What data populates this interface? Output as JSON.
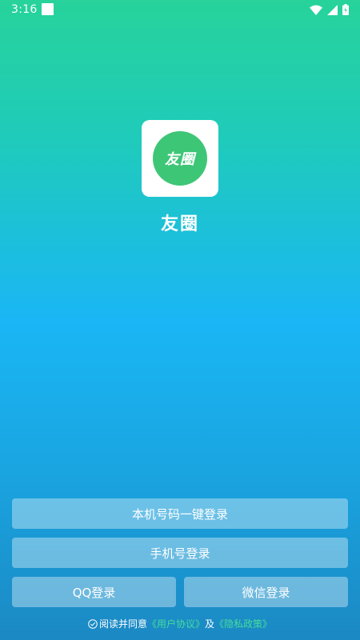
{
  "status_bar": {
    "time": "3:16",
    "icons": [
      "notification-square-icon",
      "wifi-icon",
      "signal-icon",
      "battery-icon"
    ]
  },
  "app": {
    "logo_text": "友圈",
    "name": "友圈",
    "logo_color": "#3ec677"
  },
  "buttons": {
    "one_key_login": "本机号码一键登录",
    "phone_login": "手机号登录",
    "qq_login": "QQ登录",
    "wechat_login": "微信登录"
  },
  "agreement": {
    "prefix": "阅读并同意",
    "user_agreement": "《用户协议》",
    "and": "及",
    "privacy_policy": "《隐私政策》",
    "link_color": "#45dc9c"
  }
}
